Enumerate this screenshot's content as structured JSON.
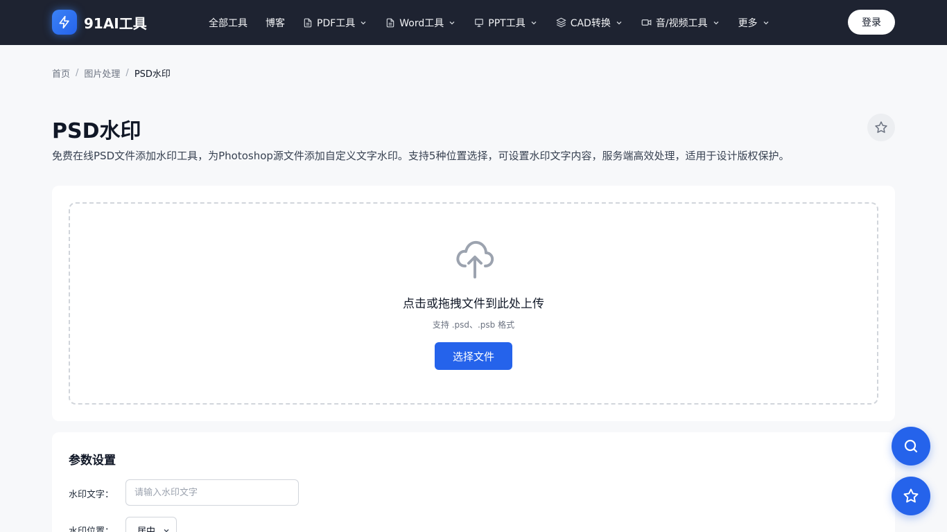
{
  "header": {
    "logo_text": "91AI工具",
    "login_label": "登录",
    "nav": [
      {
        "label": "全部工具"
      },
      {
        "label": "博客"
      },
      {
        "label": "PDF工具"
      },
      {
        "label": "Word工具"
      },
      {
        "label": "PPT工具"
      },
      {
        "label": "CAD转换"
      },
      {
        "label": "音/视频工具"
      },
      {
        "label": "更多"
      }
    ]
  },
  "breadcrumb": {
    "home": "首页",
    "category": "图片处理",
    "current": "PSD水印",
    "separator": "/"
  },
  "page": {
    "title": "PSD水印",
    "description": "免费在线PSD文件添加水印工具，为Photoshop源文件添加自定义文字水印。支持5种位置选择，可设置水印文字内容，服务端高效处理，适用于设计版权保护。"
  },
  "upload": {
    "title": "点击或拖拽文件到此处上传",
    "subtitle": "支持 .psd、.psb 格式",
    "button_label": "选择文件"
  },
  "params": {
    "title": "参数设置",
    "watermark_text_label": "水印文字：",
    "watermark_text_placeholder": "请输入水印文字",
    "watermark_text_value": "",
    "position_label": "水印位置：",
    "position_value": "居中"
  },
  "colors": {
    "header_bg": "#1e2331",
    "accent": "#2563eb",
    "page_bg": "#f7f8fa"
  },
  "icons": {
    "logo": "lightning-icon",
    "pdf": "file-icon",
    "word": "file-icon",
    "ppt": "presentation-icon",
    "cad": "layers-icon",
    "video": "video-icon",
    "favorite": "star-icon",
    "upload": "cloud-upload-icon",
    "search_fab": "search-icon",
    "favorite_fab": "star-icon"
  }
}
